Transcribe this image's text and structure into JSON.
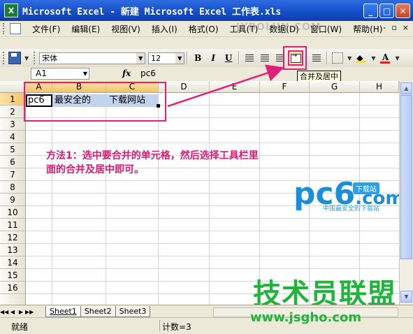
{
  "window": {
    "title": "Microsoft Excel - 新建 Microsoft Excel 工作表.xls",
    "minimize": "_",
    "restore": "□",
    "close": "✕"
  },
  "menu": {
    "items": [
      "文件(F)",
      "编辑(E)",
      "视图(V)",
      "插入(I)",
      "格式(O)",
      "工具(T)",
      "数据(D)",
      "窗口(W)",
      "帮助(H)"
    ],
    "mdi": {
      "minimize": "-",
      "restore": "▫",
      "close": "×"
    }
  },
  "toolbar": {
    "font_name": "宋体",
    "font_size": "12",
    "bold": "B",
    "italic": "I",
    "underline": "U",
    "font_color_label": "A"
  },
  "tooltip": "合并及居中",
  "formula_bar": {
    "name_box": "A1",
    "fx": "fx",
    "content": "pc6"
  },
  "sheet": {
    "columns": [
      "A",
      "B",
      "C",
      "D",
      "E",
      "F",
      "G",
      "H"
    ],
    "selected_columns": [
      "A",
      "B",
      "C"
    ],
    "rows": [
      "1",
      "2",
      "3",
      "4",
      "5",
      "6",
      "7",
      "8",
      "9",
      "10",
      "11",
      "12",
      "13",
      "14",
      "15",
      "16"
    ],
    "selected_row": "1",
    "cells": {
      "A1": "pc6",
      "B1": "最安全的",
      "C1": "下载网站"
    }
  },
  "annotation": {
    "line1": "方法1：选中要合并的单元格，然后选择工具栏里",
    "line2": "面的合并及居中即可。"
  },
  "tabs": {
    "nav": [
      "◀◀",
      "◀",
      "▶",
      "▶▶"
    ],
    "sheets": [
      "Sheet1",
      "Sheet2",
      "Sheet3"
    ],
    "active": "Sheet1"
  },
  "status": {
    "ready": "就绪",
    "count": "计数=3"
  },
  "watermarks": {
    "top": "JYBOLUN.COM",
    "pc6": "pc6",
    "pc6_com": ".com",
    "pc6_badge": "下载站",
    "pc6_tag": "中国最安全的下载站",
    "jsgho": "技术员联盟",
    "jsgho_url": "www.jsgho.com"
  },
  "colors": {
    "accent": "#e0207a",
    "annotation": "#d81b74",
    "selection": "#c3d3ec"
  }
}
